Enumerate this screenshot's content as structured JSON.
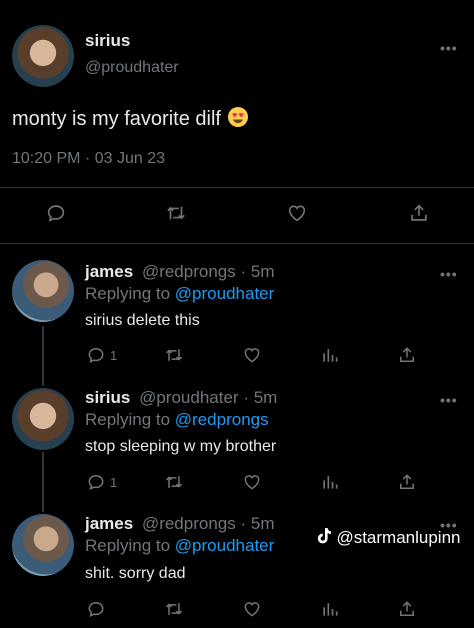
{
  "main_tweet": {
    "name": "sirius",
    "handle": "@proudhater",
    "text": "monty is my favorite dilf",
    "emoji": "heart-eyes-emoji",
    "timestamp": "10:20 PM · 03 Jun 23"
  },
  "replies": [
    {
      "name": "james",
      "handle": "@redprongs",
      "time": "· 5m",
      "replying_label": "Replying to",
      "replying_to": "@proudhater",
      "text": "sirius delete this",
      "reply_count": "1"
    },
    {
      "name": "sirius",
      "handle": "@proudhater",
      "time": "· 5m",
      "replying_label": "Replying to",
      "replying_to": "@redprongs",
      "text": "stop sleeping w my brother",
      "reply_count": "1"
    },
    {
      "name": "james",
      "handle": "@redprongs",
      "time": "· 5m",
      "replying_label": "Replying to",
      "replying_to": "@proudhater",
      "text": "shit. sorry dad",
      "reply_count": ""
    }
  ],
  "watermark": "@starmanlupinn",
  "more_glyph": "•••",
  "colors": {
    "background": "#000000",
    "text": "#e7e9ea",
    "muted": "#71767b",
    "link": "#1d9bf0",
    "divider": "#2f3336"
  }
}
